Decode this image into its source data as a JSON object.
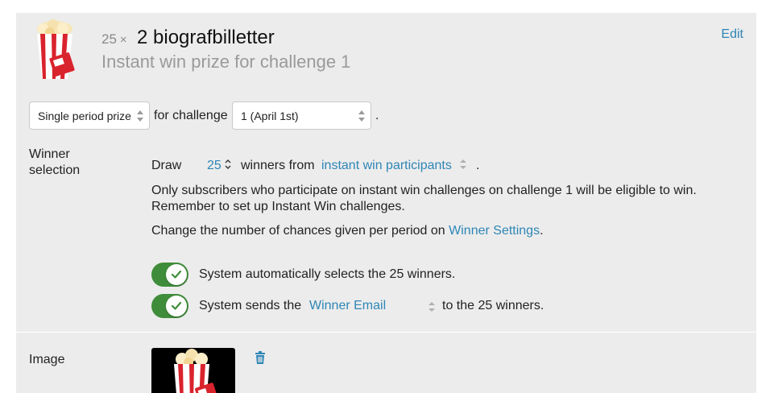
{
  "header": {
    "quantity": "25",
    "times": "×",
    "prize_title": "2 biografbilletter",
    "prize_subtitle": "Instant win prize for challenge 1",
    "edit_label": "Edit"
  },
  "period_row": {
    "period_select": "Single period prize",
    "for_challenge_label": "for challenge",
    "challenge_select": "1 (April 1st)",
    "period_end": "."
  },
  "winner_selection": {
    "label_line1": "Winner",
    "label_line2": "selection",
    "draw_label": "Draw",
    "draw_count": "25",
    "winners_from_label": "winners from",
    "source_select": "instant win participants",
    "source_end": ".",
    "eligibility_line1": "Only subscribers who participate on instant win challenges on challenge 1 will be eligible to win.",
    "eligibility_line2": "Remember to set up Instant Win challenges.",
    "chances_text": "Change the number of chances given per period on",
    "chances_link": "Winner Settings",
    "chances_end": ".",
    "auto_select_text": "System automatically selects the 25 winners.",
    "email_text_before": "System sends the",
    "email_select": "Winner Email",
    "email_text_after": "to the 25 winners."
  },
  "image_section": {
    "label": "Image"
  },
  "colors": {
    "accent": "#2e86b6",
    "toggle_on": "#3f8d3a",
    "panel_bg": "#ececec"
  },
  "icons": [
    "popcorn-icon",
    "chevron-updown-icon",
    "check-icon",
    "trash-icon"
  ]
}
